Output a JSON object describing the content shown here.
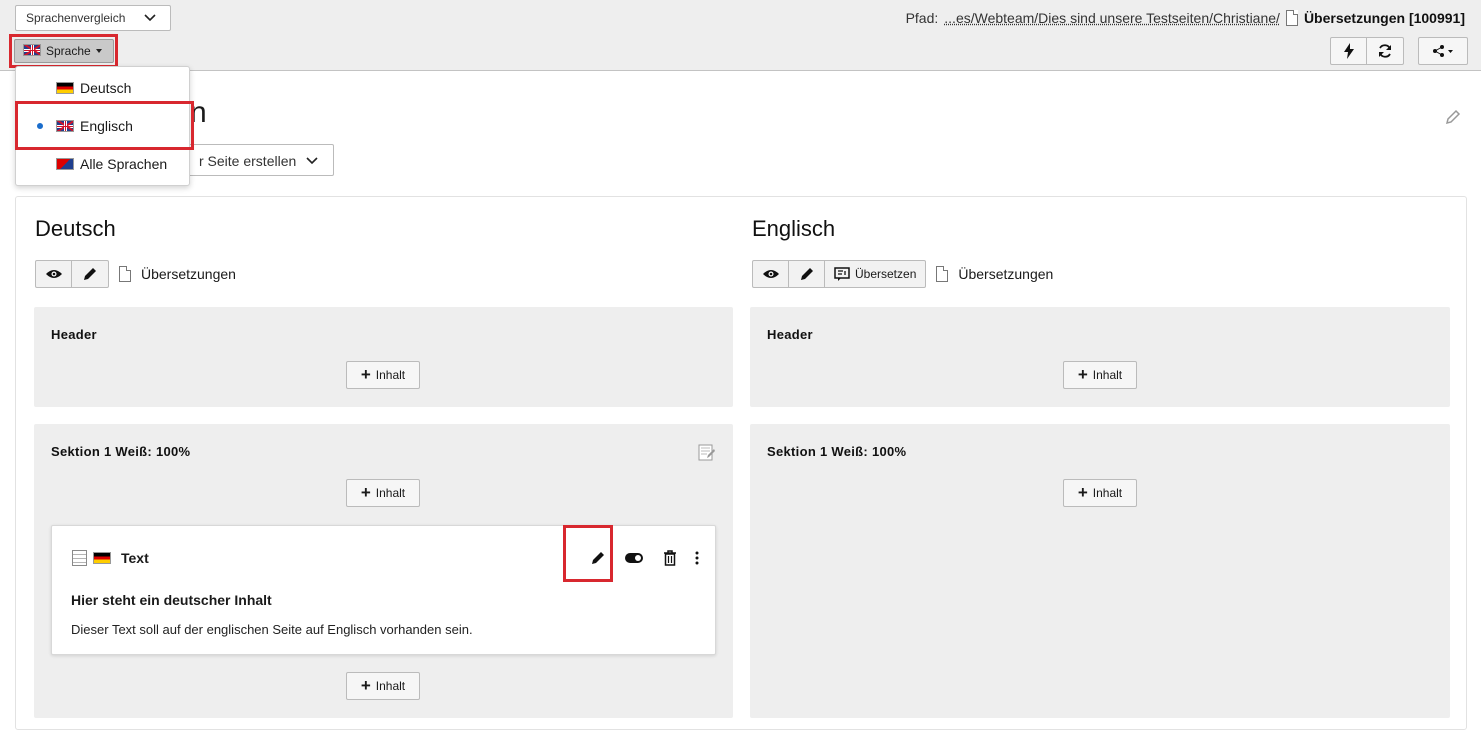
{
  "header": {
    "view_select": "Sprachenvergleich",
    "path_label": "Pfad:",
    "path_link": "...es/Webteam/Dies sind unsere Testseiten/Christiane/",
    "page_title": "Übersetzungen [100991]",
    "language_button": "Sprache"
  },
  "language_menu": {
    "items": [
      {
        "label": "Deutsch",
        "flag": "de",
        "selected": false
      },
      {
        "label": "Englisch",
        "flag": "gb",
        "selected": true
      },
      {
        "label": "Alle Sprachen",
        "flag": "multi",
        "selected": false
      }
    ]
  },
  "main": {
    "title_fragment": "n",
    "create_select": "r Seite erstellen"
  },
  "columns": {
    "left": {
      "title": "Deutsch",
      "page_name": "Übersetzungen",
      "sections": [
        {
          "title": "Header",
          "add_label": "Inhalt"
        },
        {
          "title": "Sektion 1 Weiß: 100%",
          "add_label": "Inhalt",
          "add_label_bottom": "Inhalt"
        }
      ],
      "card": {
        "type_label": "Text",
        "heading": "Hier steht ein deutscher Inhalt",
        "body": "Dieser Text soll auf der englischen Seite auf Englisch vorhanden sein."
      }
    },
    "right": {
      "title": "Englisch",
      "translate_label": "Übersetzen",
      "page_name": "Übersetzungen",
      "sections": [
        {
          "title": "Header",
          "add_label": "Inhalt"
        },
        {
          "title": "Sektion 1 Weiß: 100%",
          "add_label": "Inhalt"
        }
      ]
    }
  },
  "colors": {
    "highlight": "#d8282f",
    "docheader_bg": "#eeeeee",
    "section_bg": "#eeeeee",
    "selected_dot": "#1a6dcc"
  }
}
